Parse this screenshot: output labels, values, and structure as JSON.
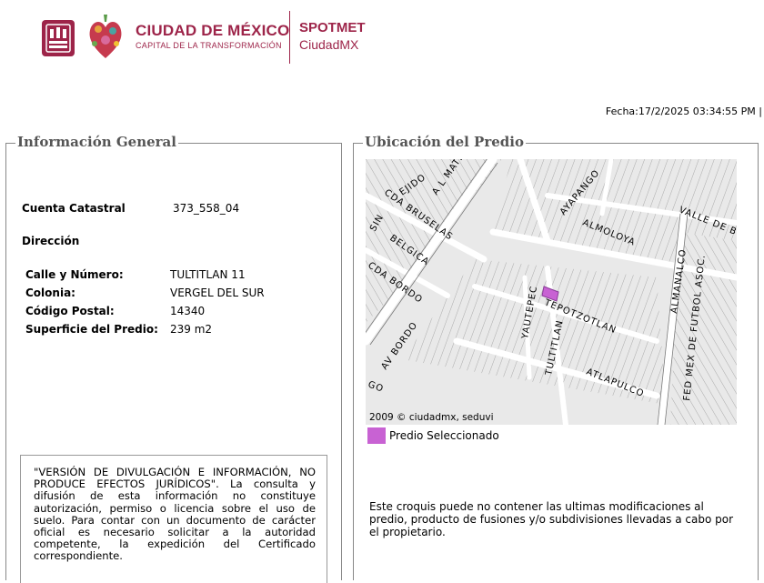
{
  "brand": {
    "title": "CIUDAD DE MÉXICO",
    "subtitle": "CAPITAL DE LA TRANSFORMACIÓN",
    "app_title": "SPOTMET",
    "app_subtitle": "CiudadMX",
    "accent_color": "#9d2449"
  },
  "fecha": "Fecha:17/2/2025 03:34:55 PM |",
  "info": {
    "section_title": "Información General",
    "cuenta_label": "Cuenta Catastral",
    "cuenta_value": "373_558_04",
    "direccion_label": "Dirección",
    "calle_label": "Calle y Número:",
    "calle_value": "TULTITLAN 11",
    "colonia_label": "Colonia:",
    "colonia_value": "VERGEL DEL SUR",
    "cp_label": "Código Postal:",
    "cp_value": "14340",
    "superficie_label": "Superficie del Predio:",
    "superficie_value": "239 m2",
    "notice": "\"VERSIÓN DE DIVULGACIÓN E INFORMACIÓN, NO PRODUCE EFECTOS JURÍDICOS\". La consulta y difusión de esta información no constituye autorización, permiso o licencia sobre el uso de suelo. Para contar con un documento de carácter oficial es necesario solicitar a la autoridad competente, la expedición del Certificado correspondiente."
  },
  "ubicacion": {
    "section_title": "Ubicación del Predio",
    "map_credit": "2009 © ciudadmx, seduvi",
    "legend_label": "Predio Seleccionado",
    "selected_color": "#c862d3",
    "disclaimer": "Este croquis puede no contener las ultimas modificaciones al predio, producto de fusiones y/o subdivisiones llevadas a cabo por el propietario.",
    "streets": {
      "ejido": "EJIDO",
      "almateo": "A L MATEO",
      "cda_bruselas": "CDA BRUSELAS",
      "sin": "SIN",
      "belgica": "BELGICA",
      "cda_bordo": "CDA BORDO",
      "av_bordo": "AV BORDO",
      "go": "GO",
      "ayapango": "AYAPANGO",
      "almoloya": "ALMOLOYA",
      "valle": "VALLE DE B",
      "yautepec": "YAUTEPEC",
      "tepotzotlan": "TEPOTZOTLAN",
      "tultitlan": "TULTITLAN",
      "atlapulco": "ATLAPULCO",
      "almanalco": "ALMANALCO",
      "fed_mex": "FED MEX DE FUTBOL ASOC."
    }
  }
}
